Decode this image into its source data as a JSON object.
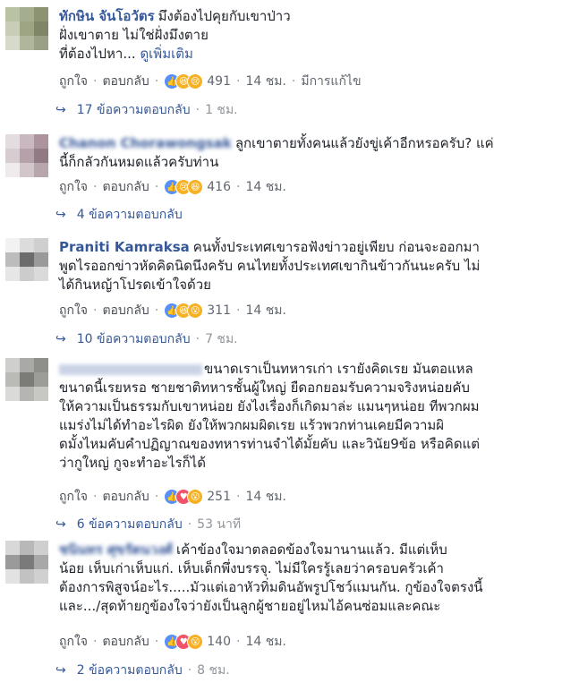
{
  "ui": {
    "like": "ถูกใจ",
    "reply": "ตอบกลับ",
    "dot": "·"
  },
  "comments": [
    {
      "name": "ทักษิน จันโอวัตร",
      "lines": [
        "มึงต้องไปคุยกับเขาป่าว",
        "ฝั่งเขาตาย ไม่ใช่ฝั่งมึงตาย"
      ],
      "tail": "ที่ต้องไปหา...",
      "see_more": "ดูเพิ่มเติม",
      "reaction_count": "491",
      "time": "14 ชม.",
      "edited": "มีการแก้ไข",
      "replies": "17 ข้อความตอบกลับ",
      "reply_time": "1 ชม.",
      "reactions": [
        "like-icon",
        "haha-icon",
        "sad-icon"
      ],
      "avatar": [
        "#b9c2a3",
        "#a4ad8d",
        "#8b9373",
        "#c9cdb8",
        "#9ea582",
        "#7f8668",
        "#d7d9ca",
        "#b0b69b",
        "#9aa086"
      ]
    },
    {
      "name": "Chanon Chorawongsak",
      "lines": [
        "ลูกเขาตายทั้งคนแล้วยังขู่เค้าอีกหรอครับ? แค่",
        "นี้ก็กลัวกันหมดแล้วครับท่าน"
      ],
      "reaction_count": "416",
      "time": "14 ชม.",
      "replies": "4 ข้อความตอบกลับ",
      "reactions": [
        "like-icon",
        "sad-icon",
        "haha-icon"
      ],
      "avatar": [
        "#e4dde0",
        "#c9b8bf",
        "#ad939d",
        "#d7cdd1",
        "#b5a1a9",
        "#927a84",
        "#efeaec",
        "#d3c6cb",
        "#b8a6ad"
      ]
    },
    {
      "name": "Praniti Kamraksa",
      "lines": [
        "คนทั้งประเทศเขารอฟังข่าวอยู่เพียบ ก่อนจะออกมา",
        "พูดไรออกข่าวหัดคิดนิดนึงครับ คนไทยทั้งประเทศเขากินข้าวกันนะครับ ไม่",
        "ได้กินหญ้าโปรดเข้าใจด้วย"
      ],
      "reaction_count": "311",
      "time": "14 ชม.",
      "replies": "10 ข้อความตอบกลับ",
      "reply_time": "7 ชม.",
      "reactions": [
        "like-icon",
        "haha-icon",
        "wow-icon"
      ],
      "avatar": [
        "#f2f2f2",
        "#dcdcdc",
        "#cfcfcf",
        "#bcbcbc",
        "#6c6c6c",
        "#9a9a9a",
        "#e6e6e6",
        "#cccccc",
        "#dadada"
      ]
    },
    {
      "name": "",
      "lines": [
        "ขนาดเราเป็นทหารเก่า เรายังคิดเรย มันตอแหล",
        "ขนาดนี้เรยหรอ ชายชาติทหารชั้นผู้ใหญ่ ยืดอกยอมรับความจริงหน่อยคับ",
        "ให้ความเป็นธรรมกับเขาหน่อย ยังไงเรื่องก็เกิดมาล่ะ แมนๆหน่อย ทีพวกผม",
        "แมร่งไม่ได้ทำอะไรผิด ยังให้พวกผมผิดเรย แร้วพวกท่านเคยมีความผิ",
        "ดมั้งไหมคับคำปฏิญาณของทหารท่านจำได้มั้ยคับ และวินัย9ข้อ หรือคิดแต่",
        "ว่ากูใหญ่ กูจะทำอะไรก็ได้"
      ],
      "reaction_count": "251",
      "time": "14 ชม.",
      "replies": "6 ข้อความตอบกลับ",
      "reply_time": "53 นาที",
      "reactions": [
        "like-icon",
        "love-icon",
        "wow-icon"
      ],
      "avatar": [
        "#cfd0cd",
        "#a9aaa5",
        "#8e8f8a",
        "#babbb6",
        "#7b7c77",
        "#9c9d98",
        "#dadbd8",
        "#b5b6b1",
        "#c7c8c4"
      ]
    },
    {
      "name": "ชนินทร ศุขรัตนวงศ์",
      "lines": [
        "เค้าข้องใจมาตลอดข้องใจมานานแล้ว. มีแต่เห็บ",
        "น้อย เห็บเก่าเห็บแก่. เห็บเด็กพึ่งบรรจุ. ไม่มีใครรู้เลยว่าครอบครัวเค้า",
        "ต้องการพิสูจน์อะไร.....มัวแต่เอาหัวทิ่มดินอัพรูปโชว์แมนกัน. กูข้องใจตรงนี้",
        "และ.../สุดท้ายกูข้องใจว่ายังเป็นลูกผู้ชายอยู่ไหมไอ้คนซ่อมและคณะ"
      ],
      "reaction_count": "140",
      "time": "14 ชม.",
      "replies": "2 ข้อความตอบกลับ",
      "reply_time": "8 ชม.",
      "reactions": [
        "like-icon",
        "love-icon",
        "wow-icon"
      ],
      "avatar": [
        "#d8d8d8",
        "#b8b8b8",
        "#cfcfcf",
        "#9a9a9a",
        "#7a7a7a",
        "#a8a8a8",
        "#e2e2e2",
        "#c2c2c2",
        "#d0d0d0"
      ]
    }
  ]
}
